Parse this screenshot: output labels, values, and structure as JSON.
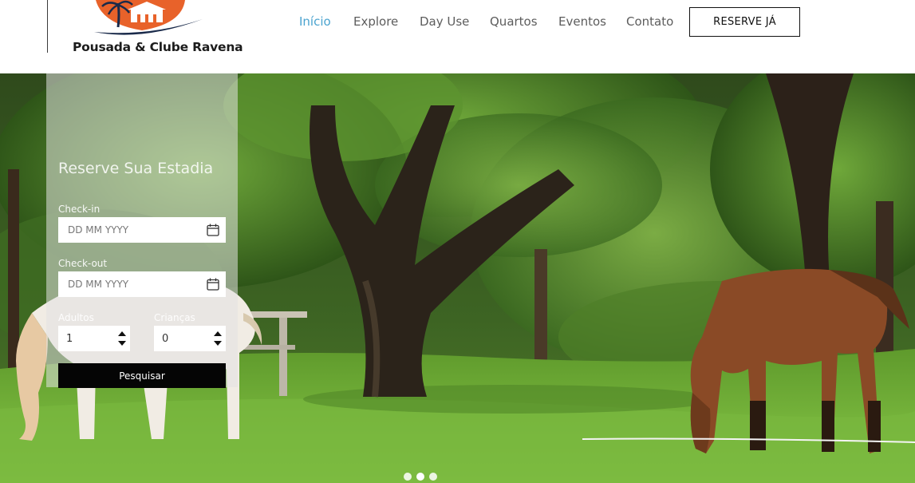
{
  "brand": {
    "name": "Pousada & Clube Ravena"
  },
  "nav": {
    "items": [
      {
        "label": "Início",
        "active": true
      },
      {
        "label": "Explore",
        "active": false
      },
      {
        "label": "Day Use",
        "active": false
      },
      {
        "label": "Quartos",
        "active": false
      },
      {
        "label": "Eventos",
        "active": false
      },
      {
        "label": "Contato",
        "active": false
      }
    ],
    "reserve_label": "RESERVE JÁ"
  },
  "booking": {
    "title": "Reserve Sua Estadia",
    "checkin_label": "Check-in",
    "checkin_placeholder": "DD MM YYYY",
    "checkout_label": "Check-out",
    "checkout_placeholder": "DD MM YYYY",
    "adults_label": "Adultos",
    "adults_value": "1",
    "children_label": "Crianças",
    "children_value": "0",
    "search_label": "Pesquisar"
  },
  "slider": {
    "dot_count": 3,
    "active_dot": 1
  },
  "colors": {
    "accent": "#4aa3cf",
    "nav_text": "#5d5d5d",
    "button_dark": "#050505",
    "logo_orange": "#e8622a"
  }
}
